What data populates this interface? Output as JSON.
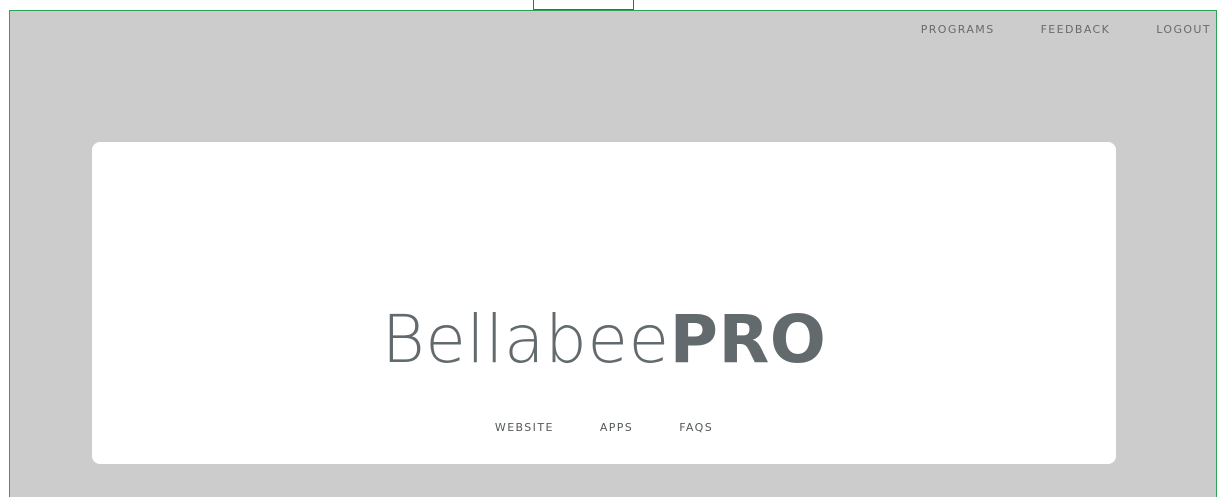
{
  "top_nav": {
    "items": [
      "PROGRAMS",
      "FEEDBACK",
      "LOGOUT"
    ]
  },
  "brand": {
    "light_text": "Bellabee",
    "bold_text": "PRO"
  },
  "footer_links": {
    "items": [
      "WEBSITE",
      "APPS",
      "FAQS"
    ]
  },
  "colors": {
    "background": "#cccccc",
    "frame_border": "#2aa454",
    "card": "#ffffff",
    "brand_text": "#636a6d"
  }
}
